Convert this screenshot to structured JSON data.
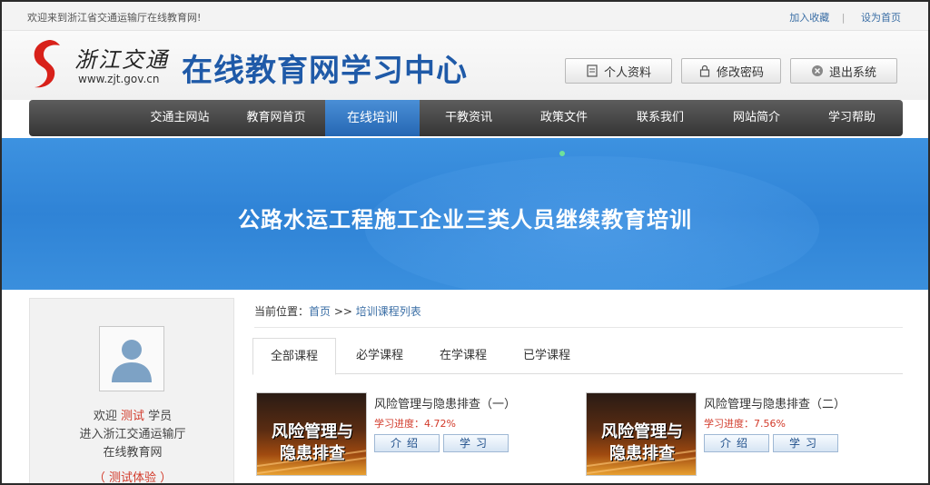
{
  "topbar": {
    "welcome": "欢迎来到浙江省交通运输厅在线教育网!",
    "add_favorite": "加入收藏",
    "separator": "|",
    "set_home": "设为首页"
  },
  "header": {
    "logo_text": "浙江交通",
    "logo_url": "www.zjt.gov.cn",
    "site_title": "在线教育网学习中心",
    "profile_button": "个人资料",
    "password_button": "修改密码",
    "logout_button": "退出系统"
  },
  "nav": {
    "items": [
      "交通主网站",
      "教育网首页",
      "在线培训",
      "干教资讯",
      "政策文件",
      "联系我们",
      "网站简介",
      "学习帮助"
    ],
    "active_index": 2
  },
  "banner": {
    "title": "公路水运工程施工企业三类人员继续教育培训"
  },
  "sidebar": {
    "welcome_prefix": "欢迎",
    "user_name": "测试",
    "welcome_suffix": "学员",
    "line2": "进入浙江交通运输厅",
    "line3": "在线教育网",
    "trial": "（ 测试体验 ）"
  },
  "breadcrumb": {
    "prefix": "当前位置：",
    "home": "首页",
    "sep": ">>",
    "current": "培训课程列表"
  },
  "tabs": [
    "全部课程",
    "必学课程",
    "在学课程",
    "已学课程"
  ],
  "courses": [
    {
      "thumb_line1": "风险管理与",
      "thumb_line2": "隐患排查",
      "title": "风险管理与隐患排查（一）",
      "progress": "学习进度：4.72%",
      "intro_button": "介绍",
      "study_button": "学习"
    },
    {
      "thumb_line1": "风险管理与",
      "thumb_line2": "隐患排查",
      "title": "风险管理与隐患排查（二）",
      "progress": "学习进度：7.56%",
      "intro_button": "介绍",
      "study_button": "学习"
    }
  ],
  "colors": {
    "brand_blue": "#1f5aa8",
    "nav_active": "#2567b3",
    "progress_red": "#d23a2a"
  }
}
